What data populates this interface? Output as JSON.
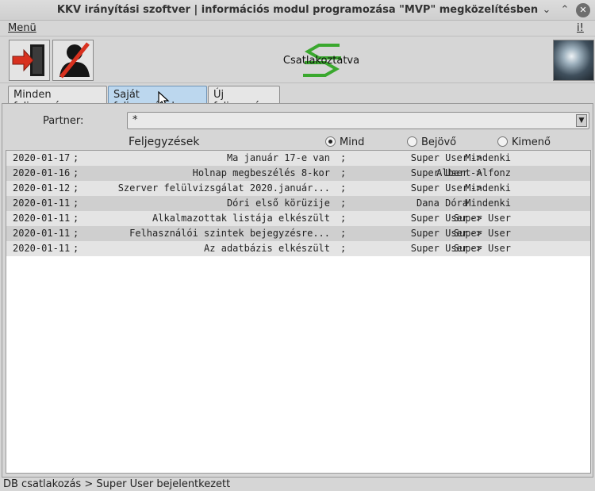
{
  "window": {
    "title": "KKV irányítási szoftver | információs modul programozása \"MVP\" megközelítésben",
    "minimize_glyph": "⌄",
    "maximize_glyph": "⌃",
    "close_glyph": "✕"
  },
  "menubar": {
    "menu_label": "Menü",
    "info_label": "i!"
  },
  "toolbar": {
    "exit_icon": "exit-door-icon",
    "logout_icon": "user-slash-icon",
    "connection_status": "Csatlakoztatva",
    "connection_icon": "green-arrows-icon",
    "avatar_icon": "avatar-image"
  },
  "tabs": [
    {
      "label": "Minden feljegyzés",
      "active": false
    },
    {
      "label": "Saját feljegyzések",
      "active": true
    },
    {
      "label": "Új feljegyzés",
      "active": false
    }
  ],
  "filter": {
    "partner_label": "Partner:",
    "partner_value": "*"
  },
  "list": {
    "heading": "Feljegyzések",
    "radios": [
      {
        "label": "Mind",
        "selected": true
      },
      {
        "label": "Bejövő",
        "selected": false
      },
      {
        "label": "Kimenő",
        "selected": false
      }
    ],
    "rows": [
      {
        "date": "2020-01-17",
        "subject": "Ma január 17-e van",
        "from": "Super User",
        "to": "Mindenki"
      },
      {
        "date": "2020-01-16",
        "subject": "Holnap megbeszélés 8-kor",
        "from": "Super User",
        "to": "Albert Alfonz"
      },
      {
        "date": "2020-01-12",
        "subject": "Szerver felülvizsgálat 2020.január...",
        "from": "Super User",
        "to": "Mindenki"
      },
      {
        "date": "2020-01-11",
        "subject": "Dóri első körüzije",
        "from": "Dana Dóra",
        "to": "Mindenki"
      },
      {
        "date": "2020-01-11",
        "subject": "Alkalmazottak listája elkészült",
        "from": "Super User",
        "to": "Super User"
      },
      {
        "date": "2020-01-11",
        "subject": "Felhasználói szintek bejegyzésre...",
        "from": "Super User",
        "to": "Super User"
      },
      {
        "date": "2020-01-11",
        "subject": "Az adatbázis elkészült",
        "from": "Super User",
        "to": "Super User"
      }
    ]
  },
  "statusbar": {
    "message": "DB csatlakozás > Super User bejelentkezett"
  },
  "colors": {
    "active_tab": "#bcd7ee",
    "connection_green": "#3aa82e",
    "exit_red": "#d8311f"
  }
}
